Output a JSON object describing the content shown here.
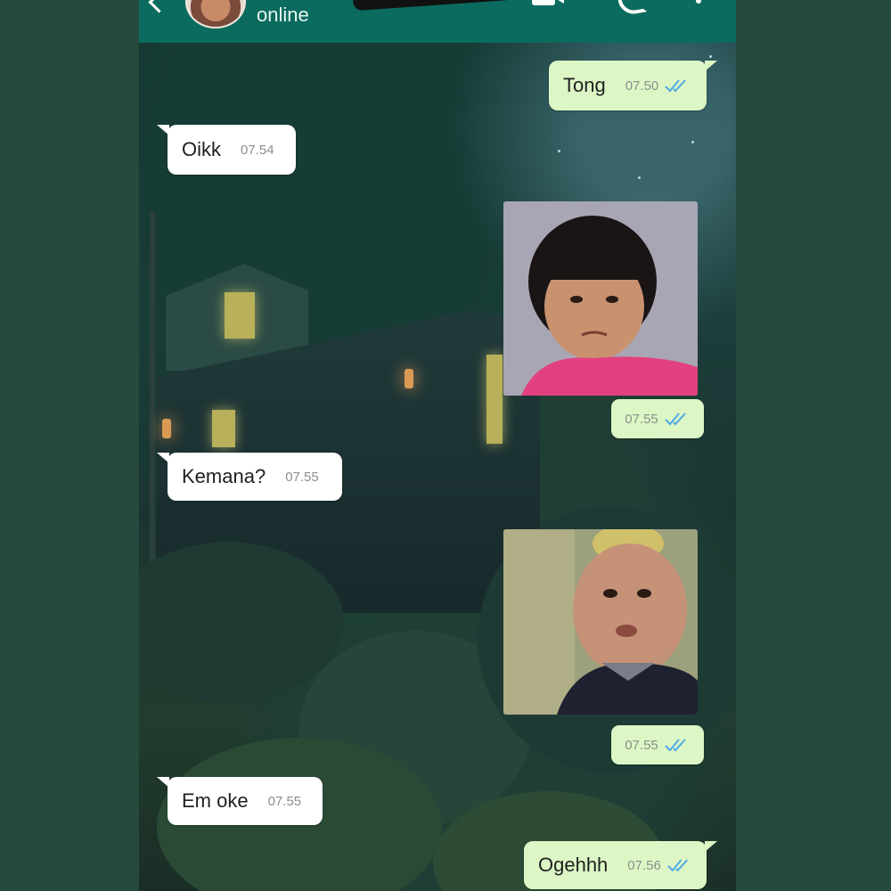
{
  "header": {
    "status": "online",
    "icons": [
      "back-icon",
      "avatar",
      "video-call-icon",
      "voice-call-icon",
      "more-menu-icon"
    ]
  },
  "messages": [
    {
      "direction": "outgoing",
      "type": "text",
      "text": "Tong",
      "time": "07.50",
      "read": true
    },
    {
      "direction": "incoming",
      "type": "text",
      "text": "Oikk",
      "time": "07.54"
    },
    {
      "direction": "outgoing",
      "type": "image",
      "subject": "girl-photo",
      "time": "07.55",
      "read": true
    },
    {
      "direction": "incoming",
      "type": "text",
      "text": "Kemana?",
      "time": "07.55"
    },
    {
      "direction": "outgoing",
      "type": "image",
      "subject": "boy-photo",
      "time": "07.55",
      "read": true
    },
    {
      "direction": "incoming",
      "type": "text",
      "text": "Em oke",
      "time": "07.55"
    },
    {
      "direction": "outgoing",
      "type": "text",
      "text": "Ogehhh",
      "time": "07.56",
      "read": true
    }
  ],
  "colors": {
    "header": "#0b6b5e",
    "outgoing_bubble": "#dcf7c5",
    "incoming_bubble": "#ffffff",
    "read_ticks": "#4fa9e6",
    "page_bg": "#254a3d"
  }
}
